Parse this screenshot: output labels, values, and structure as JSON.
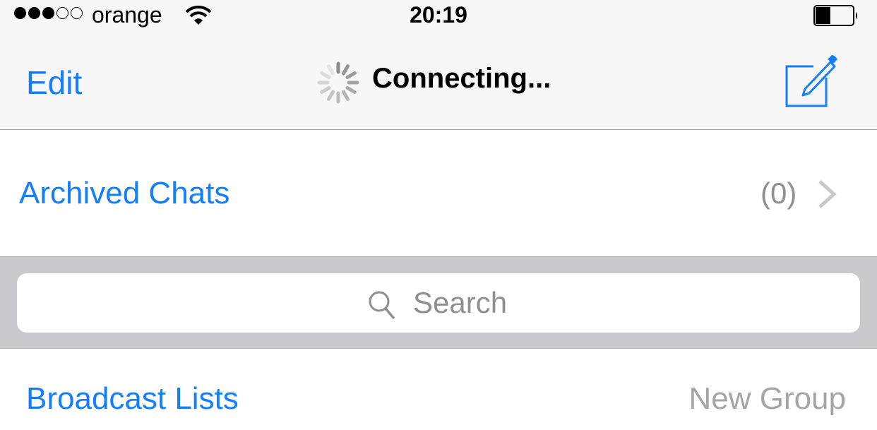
{
  "status_bar": {
    "signal_bars_filled": 3,
    "signal_bars_total": 5,
    "carrier": "orange",
    "wifi_icon": "wifi-icon",
    "time": "20:19",
    "battery_level_percent": 40
  },
  "nav_bar": {
    "edit_label": "Edit",
    "title": "Connecting...",
    "spinner_icon": "activity-spinner-icon",
    "compose_icon": "compose-icon"
  },
  "archived": {
    "label": "Archived Chats",
    "count": "(0)",
    "chevron_icon": "chevron-right-icon"
  },
  "search": {
    "placeholder": "Search",
    "icon": "search-icon"
  },
  "actions": {
    "broadcast_label": "Broadcast Lists",
    "new_group_label": "New Group"
  },
  "colors": {
    "accent": "#157efb",
    "secondary_text": "#8e8e93",
    "bar_background": "#f7f7f7",
    "search_bar_background": "#c9c9ce"
  }
}
